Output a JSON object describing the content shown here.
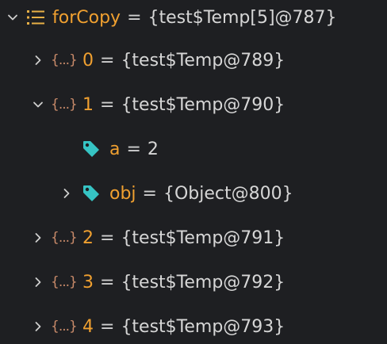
{
  "colors": {
    "background": "#1e1f22",
    "name": "#f0a030",
    "value": "#d6d6d6",
    "icon_object": "#c98b6a",
    "icon_list": "#e8b046",
    "icon_tag": "#36c4c4"
  },
  "tree": {
    "root": {
      "expanded": true,
      "icon": "list-icon",
      "name": "forCopy",
      "eq": "=",
      "value": "{test$Temp[5]@787}"
    },
    "items": [
      {
        "expanded": false,
        "icon": "object-icon",
        "icon_glyph": "{...}",
        "name": "0",
        "eq": "=",
        "value": "{test$Temp@789}"
      },
      {
        "expanded": true,
        "icon": "object-icon",
        "icon_glyph": "{...}",
        "name": "1",
        "eq": "=",
        "value": "{test$Temp@790}",
        "children": [
          {
            "expandable": false,
            "icon": "tag-icon",
            "name": "a",
            "eq": "=",
            "value": "2"
          },
          {
            "expandable": true,
            "expanded": false,
            "icon": "tag-icon",
            "name": "obj",
            "eq": "=",
            "value": "{Object@800}"
          }
        ]
      },
      {
        "expanded": false,
        "icon": "object-icon",
        "icon_glyph": "{...}",
        "name": "2",
        "eq": "=",
        "value": "{test$Temp@791}"
      },
      {
        "expanded": false,
        "icon": "object-icon",
        "icon_glyph": "{...}",
        "name": "3",
        "eq": "=",
        "value": "{test$Temp@792}"
      },
      {
        "expanded": false,
        "icon": "object-icon",
        "icon_glyph": "{...}",
        "name": "4",
        "eq": "=",
        "value": "{test$Temp@793}"
      }
    ]
  }
}
